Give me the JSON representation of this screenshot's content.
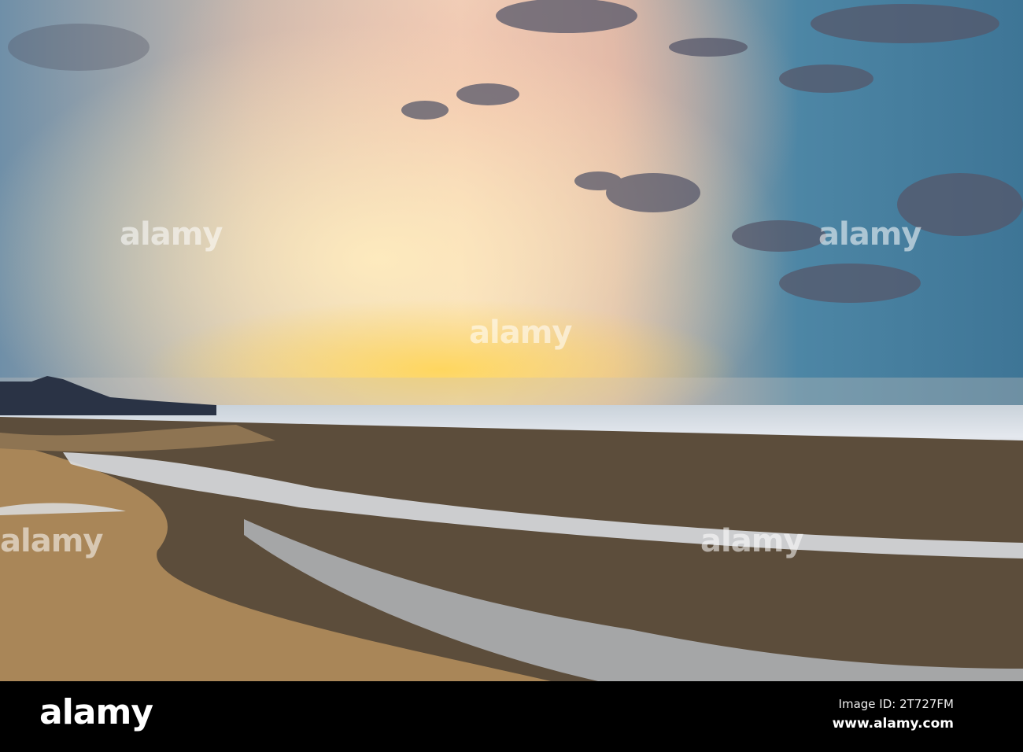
{
  "scene": {
    "subject": "sunset-beach",
    "colors": {
      "sky_warm": "#f2d6bd",
      "sky_blue": "#3e7596",
      "sand": "#a98658",
      "wet_sand": "#4a3f33",
      "water": "#e4e8ee"
    }
  },
  "watermark": {
    "text": "alamy"
  },
  "footer": {
    "logo": "alamy",
    "image_id": "Image ID: 2T727FM",
    "url": "www.alamy.com"
  }
}
